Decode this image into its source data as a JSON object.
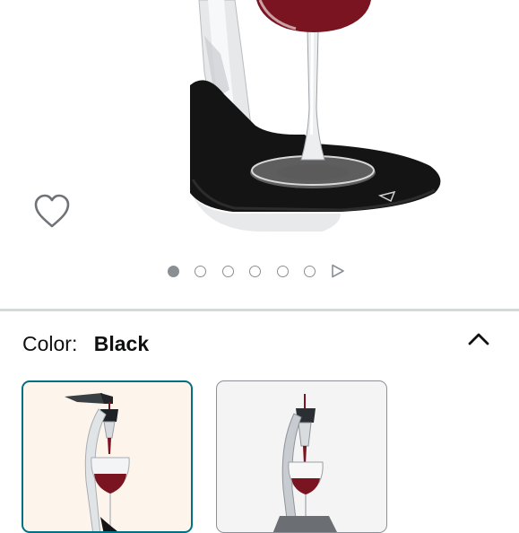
{
  "product_image": {
    "icon": "wine-glass-on-black-aerator-stand",
    "favorite_icon": "heart-outline-icon"
  },
  "carousel": {
    "total_dots": 6,
    "active_index": 0,
    "next_icon": "play-outline-icon"
  },
  "variation": {
    "label": "Color:",
    "value": "Black",
    "collapse_icon": "chevron-up-icon",
    "swatches": [
      {
        "icon": "aerator-pouring-wine-thumbnail",
        "selected": true
      },
      {
        "icon": "aerator-on-stand-gray-thumbnail",
        "selected": false
      }
    ]
  },
  "colors": {
    "selected_border": "#007185",
    "divider": "#d5d9d9",
    "dot": "#8a8f94",
    "base_black": "#141414"
  }
}
